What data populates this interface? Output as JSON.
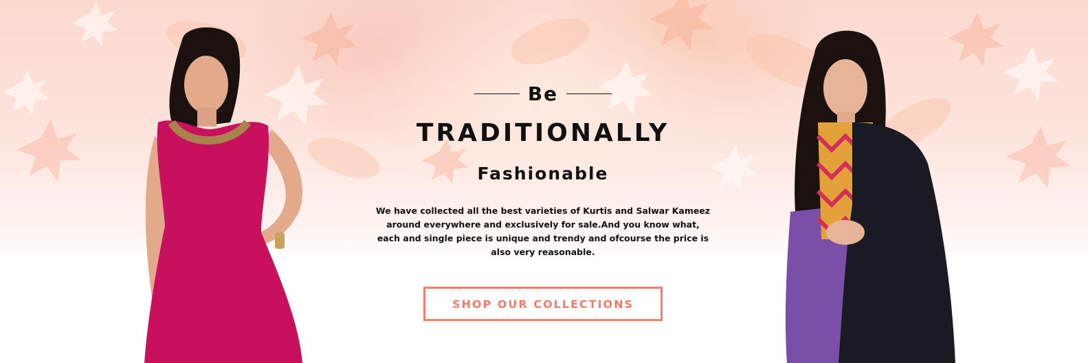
{
  "banner": {
    "eyebrow": "Be",
    "headline": "TRADITIONALLY",
    "subhead": "Fashionable",
    "description": "We have collected all the best varieties of Kurtis and Salwar Kameez around everywhere and exclusively for sale.And you know what, each and single piece is unique and trendy and ofcourse the price is also very reasonable.",
    "cta_label": "SHOP OUR COLLECTIONS"
  },
  "colors": {
    "accent": "#f47c6b",
    "text": "#111111",
    "left_dress": "#c8105e",
    "right_dupatta": "#1a1a22",
    "right_kurta": "#7a4fa8"
  }
}
